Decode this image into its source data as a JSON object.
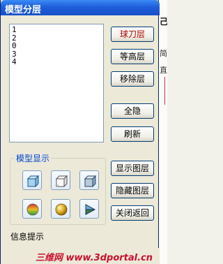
{
  "window": {
    "title": "模型分层"
  },
  "layers": {
    "items": [
      "1",
      "2",
      "0",
      "3",
      "4"
    ]
  },
  "buttons": {
    "pick_layer": "球刀层",
    "contour_layer": "等高层",
    "remove_layer": "移除层",
    "hide_all": "全隐",
    "refresh": "刷新",
    "show_layer": "显示图层",
    "hide_layer": "隐藏图层",
    "close_return": "关闭返回"
  },
  "display_group": {
    "label": "模型显示",
    "icons": [
      "box-wireframe-icon",
      "box-outline-icon",
      "box-shaded-icon",
      "sphere-gradient-icon",
      "sphere-gold-icon",
      "cone-shaded-icon"
    ]
  },
  "status": {
    "text": "信息提示"
  },
  "watermark": {
    "text": "三维网 www.3dportal.cn"
  },
  "background_app": {
    "fragment_1": "己",
    "fragment_2": "简",
    "fragment_3": "直"
  },
  "colors": {
    "title_bar": "#1e5edb",
    "accent_red": "#b00000",
    "group_label": "#0046d5",
    "watermark": "#c8102e"
  }
}
